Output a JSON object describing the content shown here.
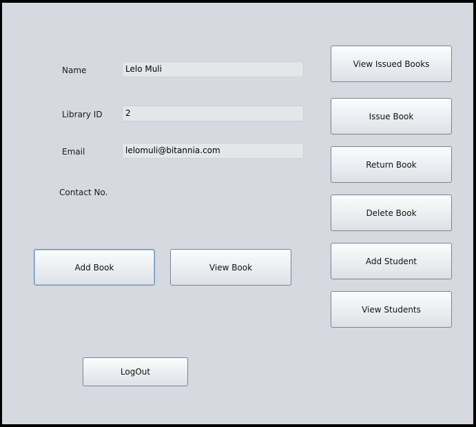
{
  "form": {
    "name_label": "Name",
    "name_value": "Lelo Muli",
    "library_id_label": "Library ID",
    "library_id_value": "2",
    "email_label": "Email",
    "email_value": "lelomuli@bitannia.com",
    "contact_label": "Contact No."
  },
  "actions": {
    "add_book": "Add Book",
    "view_book": "View Book",
    "logout": "LogOut"
  },
  "side_menu": {
    "view_issued_books": "View Issued Books",
    "issue_book": "Issue Book",
    "return_book": "Return Book",
    "delete_book": "Delete Book",
    "add_student": "Add Student",
    "view_students": "View Students"
  }
}
